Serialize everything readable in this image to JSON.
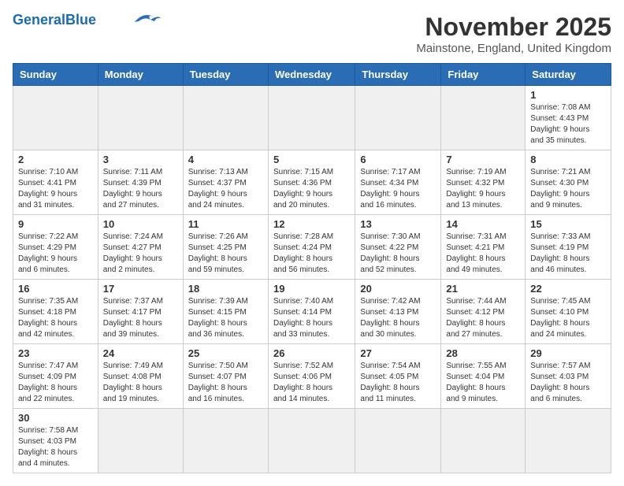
{
  "header": {
    "logo_general": "General",
    "logo_blue": "Blue",
    "month_year": "November 2025",
    "location": "Mainstone, England, United Kingdom"
  },
  "days_of_week": [
    "Sunday",
    "Monday",
    "Tuesday",
    "Wednesday",
    "Thursday",
    "Friday",
    "Saturday"
  ],
  "weeks": [
    [
      {
        "day": "",
        "info": ""
      },
      {
        "day": "",
        "info": ""
      },
      {
        "day": "",
        "info": ""
      },
      {
        "day": "",
        "info": ""
      },
      {
        "day": "",
        "info": ""
      },
      {
        "day": "",
        "info": ""
      },
      {
        "day": "1",
        "info": "Sunrise: 7:08 AM\nSunset: 4:43 PM\nDaylight: 9 hours\nand 35 minutes."
      }
    ],
    [
      {
        "day": "2",
        "info": "Sunrise: 7:10 AM\nSunset: 4:41 PM\nDaylight: 9 hours\nand 31 minutes."
      },
      {
        "day": "3",
        "info": "Sunrise: 7:11 AM\nSunset: 4:39 PM\nDaylight: 9 hours\nand 27 minutes."
      },
      {
        "day": "4",
        "info": "Sunrise: 7:13 AM\nSunset: 4:37 PM\nDaylight: 9 hours\nand 24 minutes."
      },
      {
        "day": "5",
        "info": "Sunrise: 7:15 AM\nSunset: 4:36 PM\nDaylight: 9 hours\nand 20 minutes."
      },
      {
        "day": "6",
        "info": "Sunrise: 7:17 AM\nSunset: 4:34 PM\nDaylight: 9 hours\nand 16 minutes."
      },
      {
        "day": "7",
        "info": "Sunrise: 7:19 AM\nSunset: 4:32 PM\nDaylight: 9 hours\nand 13 minutes."
      },
      {
        "day": "8",
        "info": "Sunrise: 7:21 AM\nSunset: 4:30 PM\nDaylight: 9 hours\nand 9 minutes."
      }
    ],
    [
      {
        "day": "9",
        "info": "Sunrise: 7:22 AM\nSunset: 4:29 PM\nDaylight: 9 hours\nand 6 minutes."
      },
      {
        "day": "10",
        "info": "Sunrise: 7:24 AM\nSunset: 4:27 PM\nDaylight: 9 hours\nand 2 minutes."
      },
      {
        "day": "11",
        "info": "Sunrise: 7:26 AM\nSunset: 4:25 PM\nDaylight: 8 hours\nand 59 minutes."
      },
      {
        "day": "12",
        "info": "Sunrise: 7:28 AM\nSunset: 4:24 PM\nDaylight: 8 hours\nand 56 minutes."
      },
      {
        "day": "13",
        "info": "Sunrise: 7:30 AM\nSunset: 4:22 PM\nDaylight: 8 hours\nand 52 minutes."
      },
      {
        "day": "14",
        "info": "Sunrise: 7:31 AM\nSunset: 4:21 PM\nDaylight: 8 hours\nand 49 minutes."
      },
      {
        "day": "15",
        "info": "Sunrise: 7:33 AM\nSunset: 4:19 PM\nDaylight: 8 hours\nand 46 minutes."
      }
    ],
    [
      {
        "day": "16",
        "info": "Sunrise: 7:35 AM\nSunset: 4:18 PM\nDaylight: 8 hours\nand 42 minutes."
      },
      {
        "day": "17",
        "info": "Sunrise: 7:37 AM\nSunset: 4:17 PM\nDaylight: 8 hours\nand 39 minutes."
      },
      {
        "day": "18",
        "info": "Sunrise: 7:39 AM\nSunset: 4:15 PM\nDaylight: 8 hours\nand 36 minutes."
      },
      {
        "day": "19",
        "info": "Sunrise: 7:40 AM\nSunset: 4:14 PM\nDaylight: 8 hours\nand 33 minutes."
      },
      {
        "day": "20",
        "info": "Sunrise: 7:42 AM\nSunset: 4:13 PM\nDaylight: 8 hours\nand 30 minutes."
      },
      {
        "day": "21",
        "info": "Sunrise: 7:44 AM\nSunset: 4:12 PM\nDaylight: 8 hours\nand 27 minutes."
      },
      {
        "day": "22",
        "info": "Sunrise: 7:45 AM\nSunset: 4:10 PM\nDaylight: 8 hours\nand 24 minutes."
      }
    ],
    [
      {
        "day": "23",
        "info": "Sunrise: 7:47 AM\nSunset: 4:09 PM\nDaylight: 8 hours\nand 22 minutes."
      },
      {
        "day": "24",
        "info": "Sunrise: 7:49 AM\nSunset: 4:08 PM\nDaylight: 8 hours\nand 19 minutes."
      },
      {
        "day": "25",
        "info": "Sunrise: 7:50 AM\nSunset: 4:07 PM\nDaylight: 8 hours\nand 16 minutes."
      },
      {
        "day": "26",
        "info": "Sunrise: 7:52 AM\nSunset: 4:06 PM\nDaylight: 8 hours\nand 14 minutes."
      },
      {
        "day": "27",
        "info": "Sunrise: 7:54 AM\nSunset: 4:05 PM\nDaylight: 8 hours\nand 11 minutes."
      },
      {
        "day": "28",
        "info": "Sunrise: 7:55 AM\nSunset: 4:04 PM\nDaylight: 8 hours\nand 9 minutes."
      },
      {
        "day": "29",
        "info": "Sunrise: 7:57 AM\nSunset: 4:03 PM\nDaylight: 8 hours\nand 6 minutes."
      }
    ],
    [
      {
        "day": "30",
        "info": "Sunrise: 7:58 AM\nSunset: 4:03 PM\nDaylight: 8 hours\nand 4 minutes."
      },
      {
        "day": "",
        "info": ""
      },
      {
        "day": "",
        "info": ""
      },
      {
        "day": "",
        "info": ""
      },
      {
        "day": "",
        "info": ""
      },
      {
        "day": "",
        "info": ""
      },
      {
        "day": "",
        "info": ""
      }
    ]
  ]
}
